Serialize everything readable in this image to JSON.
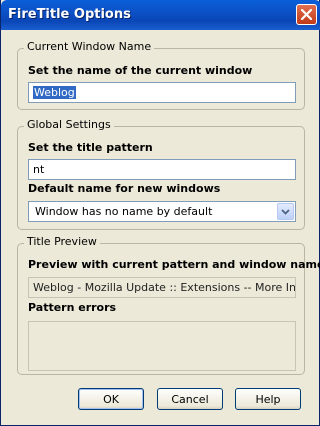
{
  "window": {
    "title": "FireTitle Options"
  },
  "current_window": {
    "legend": "Current Window Name",
    "label": "Set the name of the current window",
    "value": "Weblog"
  },
  "global_settings": {
    "legend": "Global Settings",
    "pattern_label": "Set the title pattern",
    "pattern_value": "nt",
    "default_name_label": "Default name for new windows",
    "default_name_selected": "Window has no name by default"
  },
  "title_preview": {
    "legend": "Title Preview",
    "preview_label": "Preview with current pattern and window name",
    "preview_value": "Weblog - Mozilla Update :: Extensions -- More Info:FireTitle",
    "errors_label": "Pattern errors",
    "errors_value": ""
  },
  "buttons": {
    "ok": "OK",
    "cancel": "Cancel",
    "help": "Help"
  },
  "colors": {
    "titlebar": "#0b4fc4",
    "selection": "#316ac5",
    "close": "#c23a18"
  },
  "icons": {
    "close": "close-icon",
    "dropdown": "chevron-down-icon"
  }
}
